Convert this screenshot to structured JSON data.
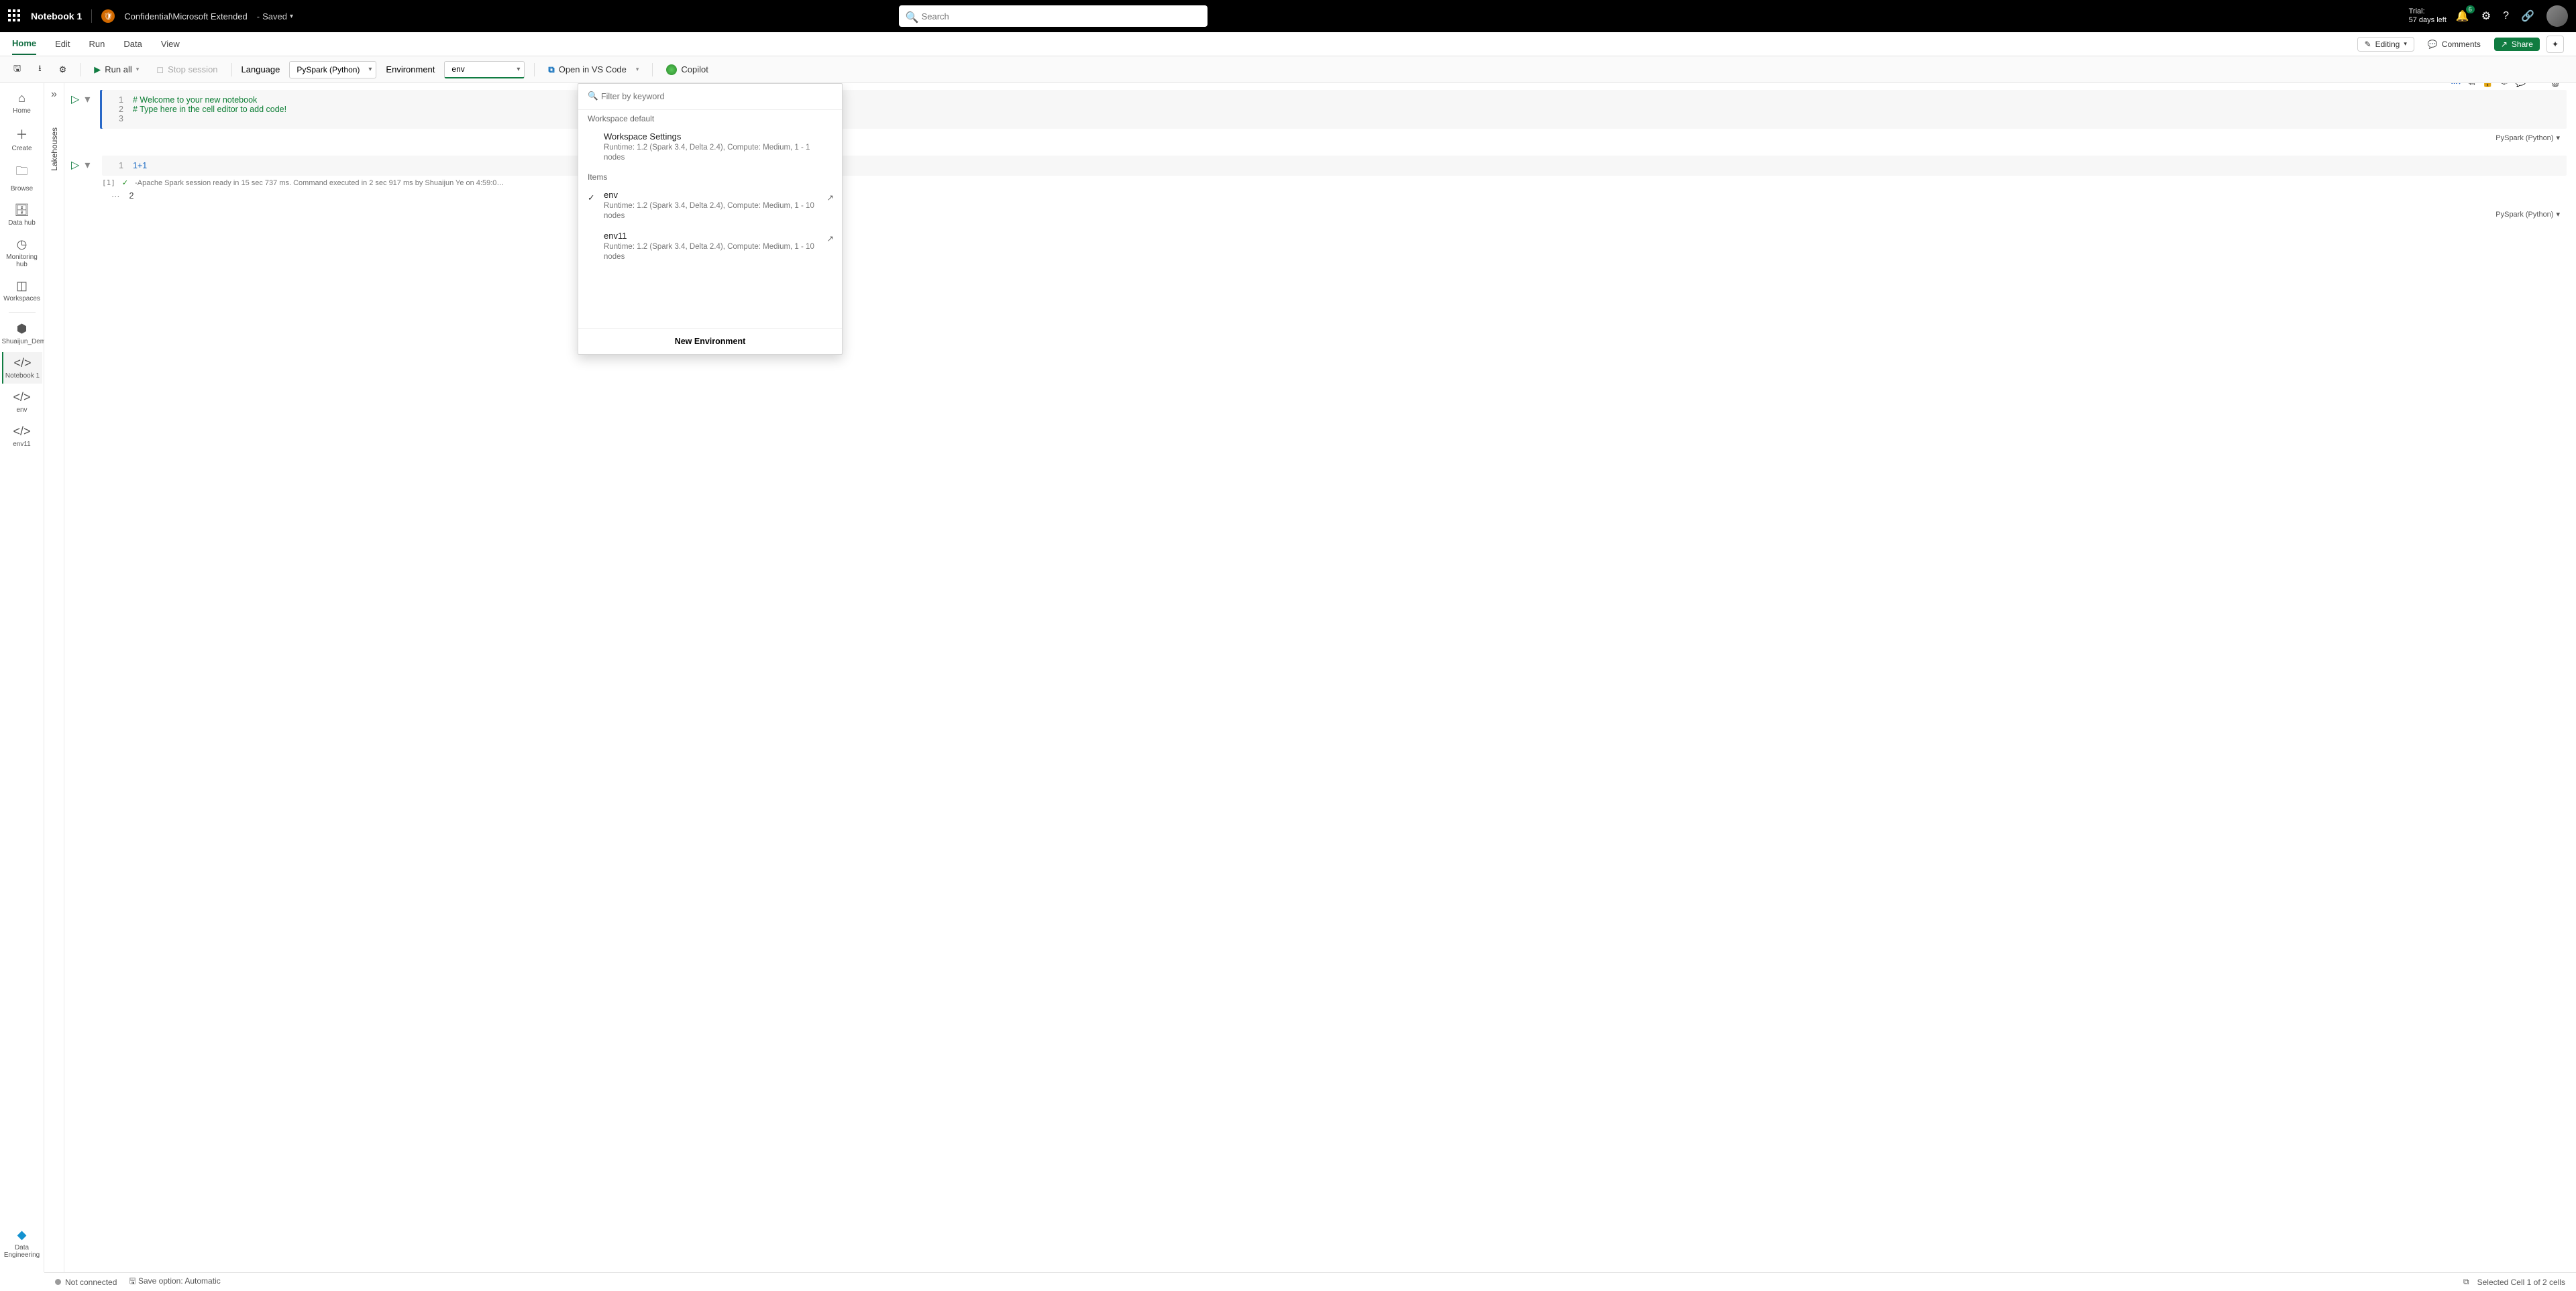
{
  "topbar": {
    "notebook_title": "Notebook 1",
    "sensitivity_label": "Confidential\\Microsoft Extended",
    "save_state": "Saved",
    "search_placeholder": "Search",
    "trial_line1": "Trial:",
    "trial_line2": "57 days left",
    "notification_badge": "6"
  },
  "tabs": {
    "items": [
      "Home",
      "Edit",
      "Run",
      "Data",
      "View"
    ],
    "editing_label": "Editing",
    "comments_label": "Comments",
    "share_label": "Share"
  },
  "toolbar": {
    "run_all": "Run all",
    "stop_session": "Stop session",
    "language_label": "Language",
    "language_value": "PySpark (Python)",
    "environment_label": "Environment",
    "environment_value": "env",
    "open_vscode": "Open in VS Code",
    "copilot": "Copilot"
  },
  "leftnav": {
    "items": [
      {
        "label": "Home"
      },
      {
        "label": "Create"
      },
      {
        "label": "Browse"
      },
      {
        "label": "Data hub"
      },
      {
        "label": "Monitoring hub"
      },
      {
        "label": "Workspaces"
      },
      {
        "label": "Shuaijun_Demo_Env"
      },
      {
        "label": "Notebook 1"
      },
      {
        "label": "env"
      },
      {
        "label": "env11"
      }
    ],
    "bottom_label": "Data Engineering"
  },
  "rail": {
    "label": "Lakehouses"
  },
  "cells": [
    {
      "lines": [
        "# Welcome to your new notebook",
        "# Type here in the cell editor to add code!",
        ""
      ],
      "lang": "PySpark (Python)"
    },
    {
      "lines": [
        "1+1"
      ],
      "lang": "PySpark (Python)",
      "out_index": "[1]",
      "out_status": "-Apache Spark session ready in 15 sec 737 ms. Command executed in 2 sec 917 ms by Shuaijun Ye on 4:59:0…",
      "out_value": "2"
    }
  ],
  "env_popup": {
    "filter_placeholder": "Filter by keyword",
    "default_header": "Workspace default",
    "default_name": "Workspace Settings",
    "default_meta": "Runtime: 1.2 (Spark 3.4, Delta 2.4), Compute: Medium, 1 - 1 nodes",
    "items_header": "Items",
    "items": [
      {
        "name": "env",
        "meta": "Runtime: 1.2 (Spark 3.4, Delta 2.4), Compute: Medium, 1 - 10 nodes",
        "selected": true
      },
      {
        "name": "env11",
        "meta": "Runtime: 1.2 (Spark 3.4, Delta 2.4), Compute: Medium, 1 - 10 nodes",
        "selected": false
      }
    ],
    "new_env": "New Environment"
  },
  "statusbar": {
    "connection": "Not connected",
    "save_option": "Save option: Automatic",
    "selection": "Selected Cell 1 of 2 cells"
  }
}
